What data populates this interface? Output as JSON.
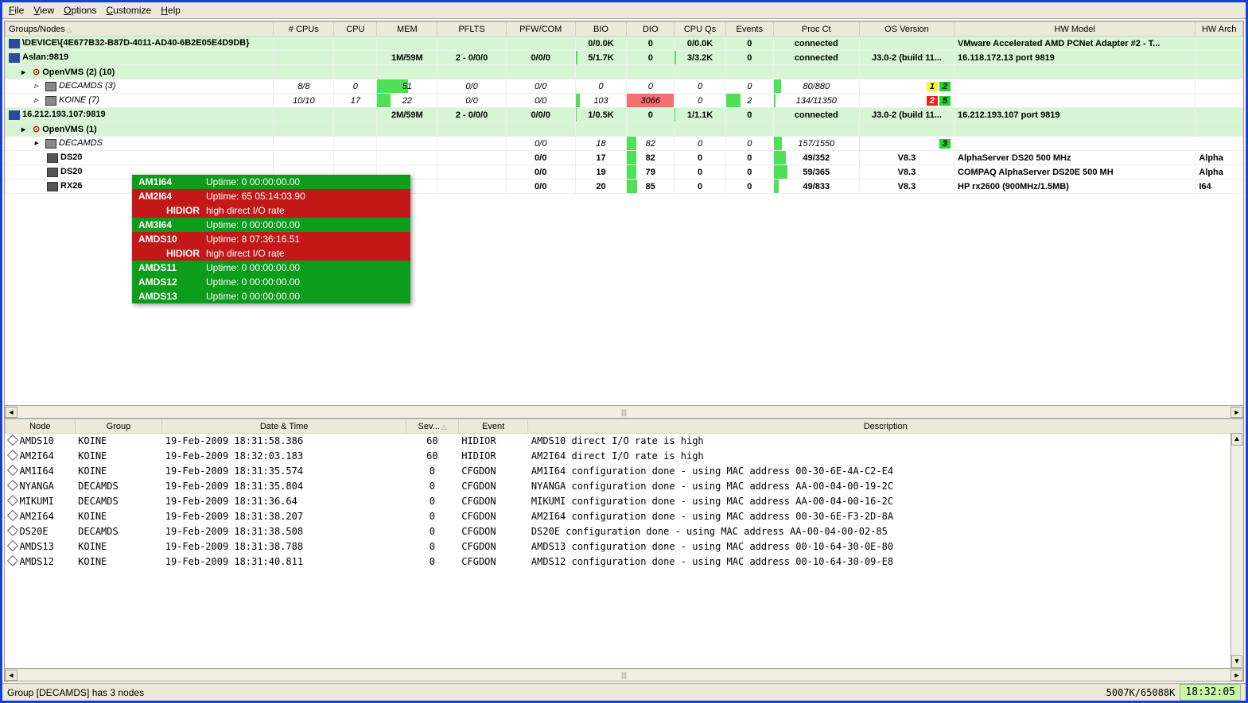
{
  "menu": {
    "file": "File",
    "view": "View",
    "options": "Options",
    "customize": "Customize",
    "help": "Help"
  },
  "upper_headers": [
    "Groups/Nodes",
    "# CPUs",
    "CPU",
    "MEM",
    "PFLTS",
    "PFW/COM",
    "BIO",
    "DIO",
    "CPU Qs",
    "Events",
    "Proc Ct",
    "OS Version",
    "HW Model",
    "HW Arch"
  ],
  "rows": [
    {
      "type": "conn",
      "cells": [
        "\\DEVICE\\{4E677B32-B87D-4011-AD40-6B2E05E4D9DB}",
        "",
        "",
        "",
        "",
        "",
        "0/0.0K",
        "0",
        "0/0.0K",
        "0",
        "connected",
        "",
        "VMware Accelerated AMD PCNet Adapter #2 - T...",
        ""
      ],
      "icon": "net"
    },
    {
      "type": "conn",
      "cells": [
        "Aslan:9819",
        "",
        "",
        "1M/59M",
        "2 - 0/0/0",
        "0/0/0",
        "5/1.7K",
        "0",
        "3/3.2K",
        "0",
        "connected",
        "J3.0-2 (build 11...",
        "16.118.172.13 port 9819",
        ""
      ],
      "icon": "srv",
      "bars": {
        "6": 4,
        "8": 3
      }
    },
    {
      "type": "group",
      "cells": [
        "OpenVMS (2) (10)",
        "",
        "",
        "",
        "",
        "",
        "",
        "",
        "",
        "",
        "",
        "",
        "",
        ""
      ],
      "indent": 1,
      "tree": "▸",
      "icon": "vms"
    },
    {
      "type": "italic",
      "cells": [
        "DECAMDS (3)",
        "8/8",
        "0",
        "51",
        "0/0",
        "0/0",
        "0",
        "0",
        "0",
        "0",
        "80/880",
        "",
        "",
        ""
      ],
      "indent": 2,
      "tree": "▹",
      "icon": "grp",
      "bars": {
        "3": 51,
        "10": 9
      },
      "badges": {
        "yellow": "1",
        "green": "2"
      }
    },
    {
      "type": "italic",
      "cells": [
        "KOINE (7)",
        "10/10",
        "17",
        "22",
        "0/0",
        "0/0",
        "103",
        "3066",
        "0",
        "2",
        "134/11350",
        "",
        "",
        ""
      ],
      "indent": 2,
      "tree": "▹",
      "icon": "grp",
      "bars": {
        "3": 22,
        "6": 8,
        "7": 100,
        "9": 30,
        "10": 2
      },
      "badges": {
        "red": "2",
        "green": "5"
      },
      "redcell": 7
    },
    {
      "type": "conn",
      "cells": [
        "16.212.193.107:9819",
        "",
        "",
        "2M/59M",
        "2 - 0/0/0",
        "0/0/0",
        "1/0.5K",
        "0",
        "1/1.1K",
        "0",
        "connected",
        "J3.0-2 (build 11...",
        "16.212.193.107 port 9819",
        ""
      ],
      "icon": "srv",
      "bars": {
        "6": 2,
        "8": 1
      }
    },
    {
      "type": "group",
      "cells": [
        "OpenVMS (1)",
        "",
        "",
        "",
        "",
        "",
        "",
        "",
        "",
        "",
        "",
        "",
        "",
        ""
      ],
      "indent": 1,
      "tree": "▸",
      "icon": "vms"
    },
    {
      "type": "italic",
      "cells": [
        "DECAMDS",
        "",
        "",
        "",
        "",
        "0/0",
        "18",
        "82",
        "0",
        "0",
        "157/1550",
        "",
        "",
        ""
      ],
      "indent": 2,
      "tree": "▸",
      "icon": "grp",
      "bars": {
        "7": 20,
        "10": 10
      },
      "badges": {
        "green": "3"
      }
    },
    {
      "type": "node",
      "cells": [
        "DS20",
        "",
        "",
        "",
        "",
        "0/0",
        "17",
        "82",
        "0",
        "0",
        "49/352",
        "V8.3",
        "AlphaServer DS20 500 MHz",
        "Alpha"
      ],
      "indent": 3,
      "icon": "host",
      "bars": {
        "7": 20,
        "10": 14
      },
      "bold": true
    },
    {
      "type": "node",
      "cells": [
        "DS20",
        "",
        "",
        "",
        "",
        "0/0",
        "19",
        "79",
        "0",
        "0",
        "59/365",
        "V8.3",
        "COMPAQ AlphaServer DS20E 500 MH",
        "Alpha"
      ],
      "indent": 3,
      "icon": "host",
      "bars": {
        "7": 19,
        "10": 16
      },
      "bold": true
    },
    {
      "type": "node",
      "cells": [
        "RX26",
        "",
        "",
        "",
        "",
        "0/0",
        "20",
        "85",
        "0",
        "0",
        "49/833",
        "V8.3",
        "HP rx2600 (900MHz/1.5MB)",
        "I64"
      ],
      "indent": 3,
      "icon": "host",
      "bars": {
        "7": 22,
        "10": 6
      },
      "bold": true
    }
  ],
  "tooltip": [
    {
      "cls": "green",
      "node": "AM1I64",
      "text": "Uptime:  0 00:00:00.00"
    },
    {
      "cls": "red",
      "node": "AM2I64",
      "text": "Uptime:  65 05:14:03.90"
    },
    {
      "cls": "red",
      "sub": "HIDIOR",
      "text": "high direct I/O rate"
    },
    {
      "cls": "green",
      "node": "AM3I64",
      "text": "Uptime:  0 00:00:00.00"
    },
    {
      "cls": "red",
      "node": "AMDS10",
      "text": "Uptime:  8 07:36:16.51"
    },
    {
      "cls": "red",
      "sub": "HIDIOR",
      "text": "high direct I/O rate"
    },
    {
      "cls": "green",
      "node": "AMDS11",
      "text": "Uptime:  0 00:00:00.00"
    },
    {
      "cls": "green",
      "node": "AMDS12",
      "text": "Uptime:  0 00:00:00.00"
    },
    {
      "cls": "green",
      "node": "AMDS13",
      "text": "Uptime:  0 00:00:00.00"
    }
  ],
  "event_headers": [
    "Node",
    "Group",
    "Date & Time",
    "Sev...",
    "Event",
    "Description"
  ],
  "events": [
    [
      "AMDS10",
      "KOINE",
      "19-Feb-2009 18:31:58.386",
      "60",
      "HIDIOR",
      "AMDS10 direct I/O rate is high"
    ],
    [
      "AM2I64",
      "KOINE",
      "19-Feb-2009 18:32:03.183",
      "60",
      "HIDIOR",
      "AM2I64 direct I/O rate is high"
    ],
    [
      "AM1I64",
      "KOINE",
      "19-Feb-2009 18:31:35.574",
      "0",
      "CFGDON",
      "AM1I64 configuration done - using MAC address 00-30-6E-4A-C2-E4"
    ],
    [
      "NYANGA",
      "DECAMDS",
      "19-Feb-2009 18:31:35.804",
      "0",
      "CFGDON",
      "NYANGA configuration done - using MAC address AA-00-04-00-19-2C"
    ],
    [
      "MIKUMI",
      "DECAMDS",
      "19-Feb-2009 18:31:36.64",
      "0",
      "CFGDON",
      "MIKUMI configuration done - using MAC address AA-00-04-00-16-2C"
    ],
    [
      "AM2I64",
      "KOINE",
      "19-Feb-2009 18:31:38.207",
      "0",
      "CFGDON",
      "AM2I64 configuration done - using MAC address 00-30-6E-F3-2D-8A"
    ],
    [
      "DS20E",
      "DECAMDS",
      "19-Feb-2009 18:31:38.508",
      "0",
      "CFGDON",
      "DS20E configuration done - using MAC address AA-00-04-00-02-85"
    ],
    [
      "AMDS13",
      "KOINE",
      "19-Feb-2009 18:31:38.788",
      "0",
      "CFGDON",
      "AMDS13 configuration done - using MAC address 00-10-64-30-0E-80"
    ],
    [
      "AMDS12",
      "KOINE",
      "19-Feb-2009 18:31:40.811",
      "0",
      "CFGDON",
      "AMDS12 configuration done - using MAC address 00-10-64-30-09-E8"
    ]
  ],
  "status": {
    "text": "Group [DECAMDS] has 3 nodes",
    "mem": "5007K/65088K",
    "clock": "18:32:05"
  },
  "col_widths_upper": [
    220,
    70,
    50,
    70,
    80,
    80,
    60,
    55,
    60,
    55,
    100,
    110,
    280,
    55
  ],
  "col_widths_lower": [
    80,
    100,
    280,
    60,
    80,
    820
  ]
}
